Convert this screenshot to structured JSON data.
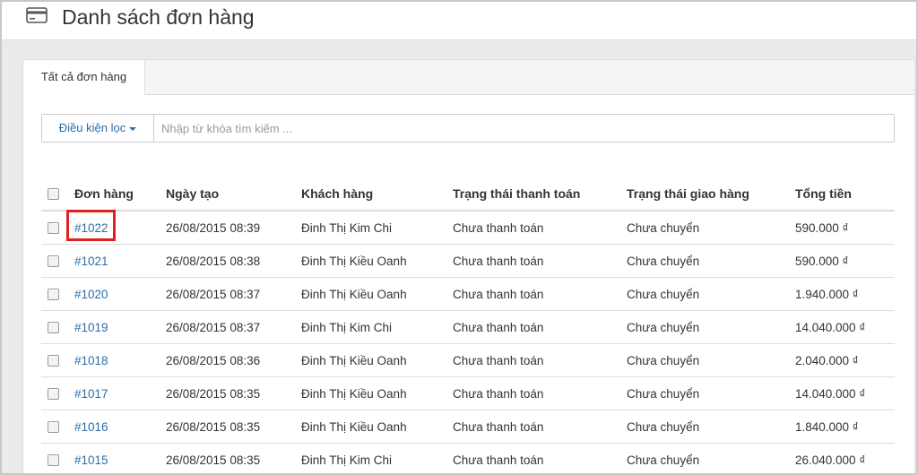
{
  "page": {
    "title": "Danh sách đơn hàng",
    "icon": "credit-card-icon"
  },
  "tabs": [
    {
      "label": "Tất cả đơn hàng",
      "active": true
    }
  ],
  "filter": {
    "button_label": "Điều kiện lọc",
    "search_placeholder": "Nhập từ khóa tìm kiếm ...",
    "search_value": ""
  },
  "table": {
    "columns": [
      "Đơn hàng",
      "Ngày tạo",
      "Khách hàng",
      "Trạng thái thanh toán",
      "Trạng thái giao hàng",
      "Tổng tiền"
    ],
    "rows": [
      {
        "order": "#1022",
        "date": "26/08/2015 08:39",
        "customer": "Đinh Thị Kim Chi",
        "payment": "Chưa thanh toán",
        "shipping": "Chưa chuyển",
        "total": "590.000 ₫",
        "highlighted": true
      },
      {
        "order": "#1021",
        "date": "26/08/2015 08:38",
        "customer": "Đinh Thị Kiều Oanh",
        "payment": "Chưa thanh toán",
        "shipping": "Chưa chuyển",
        "total": "590.000 ₫"
      },
      {
        "order": "#1020",
        "date": "26/08/2015 08:37",
        "customer": "Đinh Thị Kiều Oanh",
        "payment": "Chưa thanh toán",
        "shipping": "Chưa chuyển",
        "total": "1.940.000 ₫"
      },
      {
        "order": "#1019",
        "date": "26/08/2015 08:37",
        "customer": "Đinh Thị Kim Chi",
        "payment": "Chưa thanh toán",
        "shipping": "Chưa chuyển",
        "total": "14.040.000 ₫"
      },
      {
        "order": "#1018",
        "date": "26/08/2015 08:36",
        "customer": "Đinh Thị Kiều Oanh",
        "payment": "Chưa thanh toán",
        "shipping": "Chưa chuyển",
        "total": "2.040.000 ₫"
      },
      {
        "order": "#1017",
        "date": "26/08/2015 08:35",
        "customer": "Đinh Thị Kiều Oanh",
        "payment": "Chưa thanh toán",
        "shipping": "Chưa chuyển",
        "total": "14.040.000 ₫"
      },
      {
        "order": "#1016",
        "date": "26/08/2015 08:35",
        "customer": "Đinh Thị Kiều Oanh",
        "payment": "Chưa thanh toán",
        "shipping": "Chưa chuyển",
        "total": "1.840.000 ₫"
      },
      {
        "order": "#1015",
        "date": "26/08/2015 08:35",
        "customer": "Đinh Thị Kim Chi",
        "payment": "Chưa thanh toán",
        "shipping": "Chưa chuyển",
        "total": "26.040.000 ₫"
      }
    ]
  },
  "colors": {
    "link": "#2e6da4",
    "highlight_box": "#e02020"
  }
}
